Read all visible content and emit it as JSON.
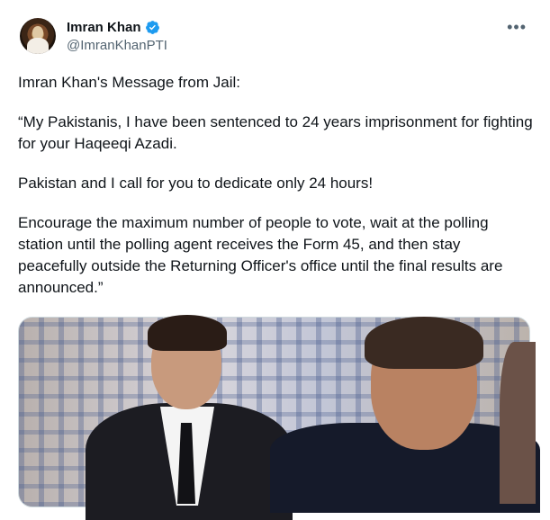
{
  "author": {
    "display_name": "Imran Khan",
    "handle": "@ImranKhanPTI",
    "verified": true,
    "verified_color": "#1d9bf0"
  },
  "menu_icon": "more-horizontal-icon",
  "tweet": {
    "paragraphs": [
      "Imran Khan's Message from Jail:",
      "“My Pakistanis, I have been sentenced to 24 years imprisonment for fighting for your Haqeeqi Azadi.",
      "Pakistan and I call for you to dedicate only 24 hours!",
      "Encourage the maximum number of people to vote, wait at the polling station until the polling agent receives the Form 45, and then stay peacefully outside the Returning Officer's office until the final results are announced.”"
    ]
  }
}
